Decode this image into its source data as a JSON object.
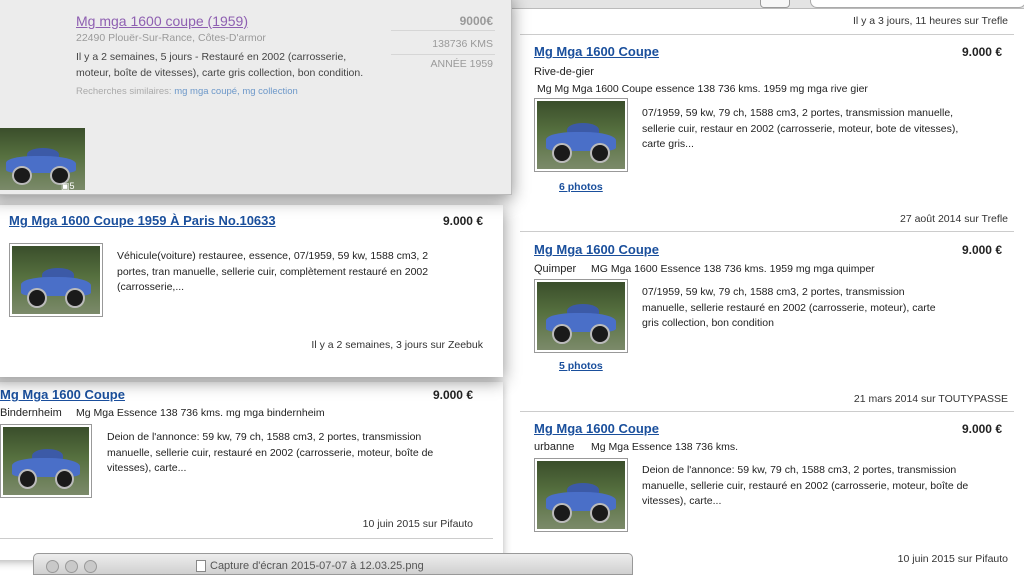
{
  "right": {
    "top_source": "Il y a 3 jours, 11 heures sur Trefle",
    "listings": [
      {
        "title": "Mg Mga 1600 Coupe",
        "price": "9.000 €",
        "loc": "Rive-de-gier",
        "sub": "Mg Mg Mga 1600 Coupe essence 138 736 kms. 1959  mg mga rive gier",
        "desc": "07/1959, 59 kw, 79 ch, 1588 cm3, 2 portes, transmission manuelle, sellerie cuir, restaur en 2002 (carrosserie, moteur, bote de vitesses), carte gris...",
        "photos": "6 photos",
        "source": "27 août 2014 sur Trefle"
      },
      {
        "title": "Mg Mga 1600 Coupe",
        "price": "9.000 €",
        "loc": "Quimper",
        "sub": "MG Mga 1600 Essence 138 736 kms. 1959  mg mga quimper",
        "desc": "07/1959, 59 kw, 79 ch, 1588 cm3, 2 portes, transmission manuelle, sellerie restauré en 2002 (carrosserie, moteur), carte gris collection, bon condition",
        "photos": "5 photos",
        "source": "21 mars 2014 sur TOUTYPASSE"
      },
      {
        "title": "Mg Mga 1600 Coupe",
        "price": "9.000 €",
        "loc": "urbanne",
        "sub": "Mg Mga Essence 138 736 kms.",
        "desc": "Deion de l'annonce: 59 kw, 79 ch, 1588 cm3, 2 portes, transmission manuelle, sellerie cuir, restauré en 2002 (carrosserie, moteur, boîte de vitesses), carte...",
        "source": "10 juin 2015 sur Pifauto"
      }
    ]
  },
  "win1": {
    "title": "Mg mga 1600 coupe (1959)",
    "price": "9000€",
    "location": "22490 Plouër-Sur-Rance, Côtes-D'armor",
    "kms": "138736 KMS",
    "year": "ANNÉE 1959",
    "desc": "Il y a 2 semaines, 5 jours - Restauré en 2002 (carrosserie, moteur, boîte de vitesses), carte gris collection, bon condition.",
    "similar_label": "Recherches similaires:",
    "similar": "mg mga coupé, mg collection",
    "photo_count": "5"
  },
  "win2": {
    "title": "Mg Mga 1600 Coupe 1959 À Paris No.10633",
    "price": "9.000 €",
    "desc": "Véhicule(voiture) restauree, essence, 07/1959, 59 kw, 1588 cm3, 2 portes, tran manuelle, sellerie cuir, complètement restauré en 2002 (carrosserie,...",
    "source": "Il y a 2 semaines, 3 jours sur Zeebuk"
  },
  "win3": {
    "title": "Mg Mga 1600 Coupe",
    "price": "9.000 €",
    "loc": "Bindernheim",
    "sub": "Mg Mga Essence 138 736 kms.  mg mga bindernheim",
    "desc": "Deion de l'annonce: 59 kw, 79 ch, 1588 cm3, 2 portes, transmission manuelle, sellerie cuir, restauré en 2002 (carrosserie, moteur, boîte de vitesses), carte...",
    "source": "10 juin 2015 sur Pifauto"
  },
  "bottom_window": {
    "title": "Capture d'écran 2015-07-07 à 12.03.25.png"
  }
}
